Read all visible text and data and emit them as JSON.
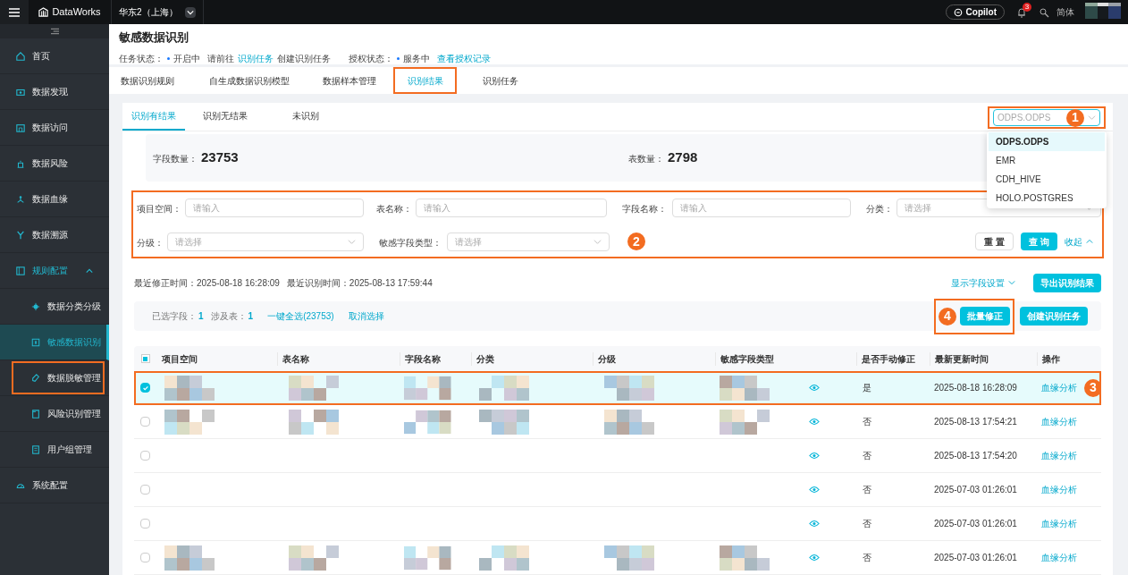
{
  "top_bar": {
    "product": "DataWorks",
    "region": "华东2（上海）",
    "copilot": "Copilot",
    "notification_count": "3",
    "language": "简体"
  },
  "sidebar": {
    "items": [
      {
        "label": "首页",
        "selected": false
      },
      {
        "label": "数据发现",
        "selected": false
      },
      {
        "label": "数据访问",
        "selected": false
      },
      {
        "label": "数据风险",
        "selected": false
      },
      {
        "label": "数据血缘",
        "selected": false
      },
      {
        "label": "数据溯源",
        "selected": false
      },
      {
        "label": "规则配置",
        "selected": false,
        "expanded": true,
        "children": [
          {
            "label": "数据分类分级",
            "selected": false,
            "highlighted": false
          },
          {
            "label": "敏感数据识别",
            "selected": true,
            "highlighted": false
          },
          {
            "label": "数据脱敏管理",
            "selected": false,
            "highlighted": true
          },
          {
            "label": "风险识别管理",
            "selected": false,
            "highlighted": false
          },
          {
            "label": "用户组管理",
            "selected": false,
            "highlighted": false
          }
        ]
      },
      {
        "label": "系统配置",
        "selected": false
      }
    ]
  },
  "page": {
    "title": "敏感数据识别",
    "task_status_label": "任务状态：",
    "task_status": "开启中",
    "hint_before": "请前往",
    "hint_link": "识别任务",
    "hint_after": "创建识别任务",
    "auth_status_label": "授权状态：",
    "auth_status": "服务中",
    "auth_link": "查看授权记录"
  },
  "tabs": [
    {
      "label": "数据识别规则",
      "selected": false,
      "highlighted": false
    },
    {
      "label": "自生成数据识别模型",
      "selected": false,
      "highlighted": false
    },
    {
      "label": "数据样本管理",
      "selected": false,
      "highlighted": false
    },
    {
      "label": "识别结果",
      "selected": true,
      "highlighted": true
    },
    {
      "label": "识别任务",
      "selected": false,
      "highlighted": false
    }
  ],
  "sub_tabs": [
    {
      "label": "识别有结果",
      "selected": true
    },
    {
      "label": "识别无结果",
      "selected": false
    },
    {
      "label": "未识别",
      "selected": false
    }
  ],
  "source_select": {
    "placeholder": "ODPS.ODPS",
    "highlighted": true,
    "callout": "1",
    "expanded": true,
    "options": [
      {
        "label": "ODPS.ODPS",
        "selected": true
      },
      {
        "label": "EMR",
        "selected": false
      },
      {
        "label": "CDH_HIVE",
        "selected": false
      },
      {
        "label": "HOLO.POSTGRES",
        "selected": false
      }
    ]
  },
  "stats": [
    {
      "label": "字段数量：",
      "value": "23753"
    },
    {
      "label": "表数量：",
      "value": "2798"
    }
  ],
  "filters": {
    "highlighted": true,
    "callout": "2",
    "rows": [
      [
        {
          "label": "项目空间：",
          "kind": "input",
          "placeholder": "请输入"
        },
        {
          "label": "表名称：",
          "kind": "input",
          "placeholder": "请输入"
        },
        {
          "label": "字段名称：",
          "kind": "input",
          "placeholder": "请输入"
        },
        {
          "label": "分类：",
          "kind": "select",
          "placeholder": "请选择"
        }
      ],
      [
        {
          "label": "分级：",
          "kind": "select",
          "placeholder": "请选择"
        },
        {
          "label": "敏感字段类型：",
          "kind": "select",
          "placeholder": "请选择"
        }
      ]
    ],
    "buttons": [
      {
        "label": "重 置",
        "kind": "default"
      },
      {
        "label": "查 询",
        "kind": "primary"
      }
    ],
    "collapse_link": "收起"
  },
  "times": {
    "modified_label": "最近修正时间：",
    "modified": "2025-08-18 16:28:09",
    "identified_label": "最近识别时间：",
    "identified": "2025-08-13 17:59:44"
  },
  "column_settings": "显示字段设置",
  "export_button": "导出识别结果",
  "selection_bar": {
    "fields_label": "已选字段：",
    "fields_count": "1",
    "tables_label": "涉及表：",
    "tables_count": "1",
    "select_all": "一键全选(23753)",
    "clear": "取消选择",
    "buttons": [
      {
        "label": "批量修正",
        "callout": "4"
      },
      {
        "label": "创建识别任务"
      }
    ]
  },
  "table": {
    "header_indeterminate": true,
    "columns": [
      "项目空间",
      "表名称",
      "字段名称",
      "分类",
      "分级",
      "敏感字段类型",
      "是否手动修正",
      "最新更新时间",
      "操作"
    ],
    "rows": [
      {
        "checked": true,
        "masked": true,
        "highlighted": true,
        "callout": "3",
        "manual": "是",
        "updated": "2025-08-18 16:28:09",
        "action": "血缘分析"
      },
      {
        "checked": false,
        "masked": true,
        "highlighted": false,
        "manual": "否",
        "updated": "2025-08-13 17:54:21",
        "action": "血缘分析"
      },
      {
        "checked": false,
        "masked": false,
        "highlighted": false,
        "manual": "否",
        "updated": "2025-08-13 17:54:20",
        "action": "血缘分析"
      },
      {
        "checked": false,
        "masked": false,
        "highlighted": false,
        "manual": "否",
        "updated": "2025-07-03 01:26:01",
        "action": "血缘分析"
      },
      {
        "checked": false,
        "masked": false,
        "highlighted": false,
        "manual": "否",
        "updated": "2025-07-03 01:26:01",
        "action": "血缘分析"
      },
      {
        "checked": false,
        "masked": true,
        "highlighted": false,
        "manual": "否",
        "updated": "2025-07-03 01:26:01",
        "action": "血缘分析"
      }
    ]
  }
}
